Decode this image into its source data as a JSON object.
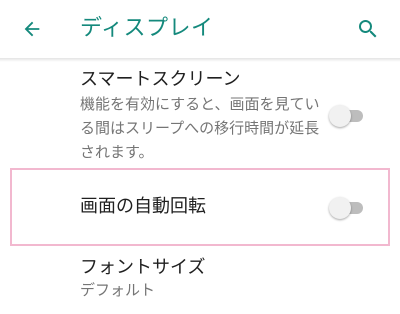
{
  "appbar": {
    "title": "ディスプレイ",
    "back_icon": "arrow-left-icon",
    "search_icon": "search-icon",
    "accent_color": "#14897c"
  },
  "settings": {
    "smart_screen": {
      "title": "スマートスクリーン",
      "summary": "機能を有効にすると、画面を見ている間はスリープへの移行時間が延長されます。",
      "enabled": false
    },
    "auto_rotate": {
      "title": "画面の自動回転",
      "enabled": false,
      "highlight_color": "#f2b8cf"
    },
    "font_size": {
      "title": "フォントサイズ",
      "value": "デフォルト"
    }
  }
}
